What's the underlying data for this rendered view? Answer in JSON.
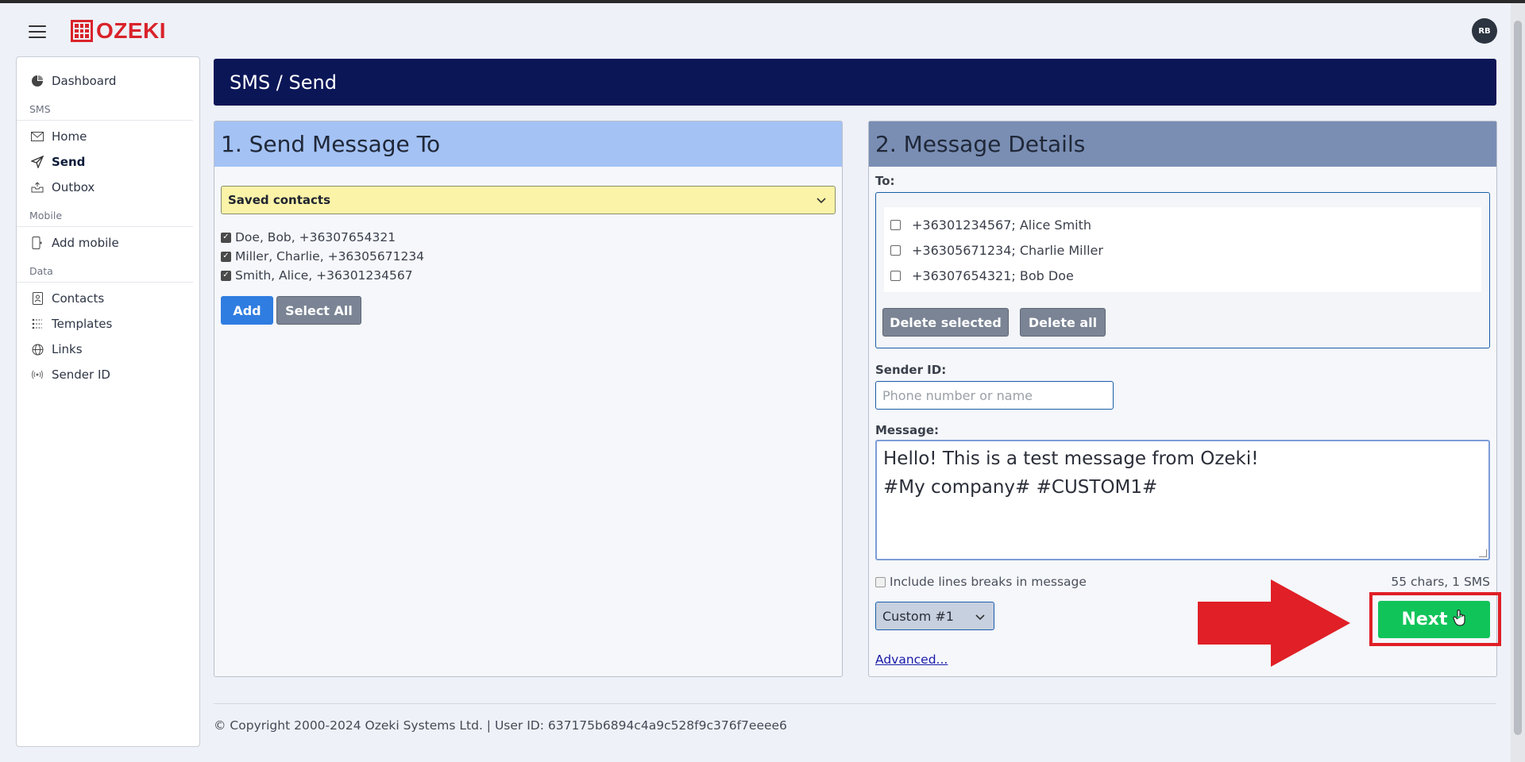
{
  "app": {
    "logo_text": "OZEKI",
    "avatar_initials": "RB"
  },
  "sidebar": {
    "dashboard": "Dashboard",
    "section_sms": "SMS",
    "home": "Home",
    "send": "Send",
    "outbox": "Outbox",
    "section_mobile": "Mobile",
    "add_mobile": "Add mobile",
    "section_data": "Data",
    "contacts": "Contacts",
    "templates": "Templates",
    "links": "Links",
    "sender_id": "Sender ID"
  },
  "header": {
    "title": "SMS / Send"
  },
  "send_to": {
    "heading": "1. Send Message To",
    "source_select": "Saved contacts",
    "contacts": [
      {
        "label": "Doe, Bob, +36307654321",
        "checked": true
      },
      {
        "label": "Miller, Charlie, +36305671234",
        "checked": true
      },
      {
        "label": "Smith, Alice, +36301234567",
        "checked": true
      }
    ],
    "add_label": "Add",
    "select_all_label": "Select All"
  },
  "details": {
    "heading": "2. Message Details",
    "to_label": "To:",
    "recipients": [
      {
        "label": "+36301234567; Alice Smith",
        "checked": false
      },
      {
        "label": "+36305671234; Charlie Miller",
        "checked": false
      },
      {
        "label": "+36307654321; Bob Doe",
        "checked": false
      }
    ],
    "delete_selected_label": "Delete selected",
    "delete_all_label": "Delete all",
    "sender_id_label": "Sender ID:",
    "sender_id_placeholder": "Phone number or name",
    "message_label": "Message:",
    "message_line1": "Hello! This is a test message from Ozeki!",
    "message_line2": "#My company# #CUSTOM1#",
    "include_breaks_label": "Include lines breaks in message",
    "counter": "55 chars, 1 SMS",
    "custom_select": "Custom #1",
    "advanced_link": "Advanced...",
    "next_label": "Next"
  },
  "footer": {
    "copyright": "© Copyright 2000-2024 Ozeki Systems Ltd. | User ID: 637175b6894c4a9c528f9c376f7eeee6"
  },
  "colors": {
    "header_bg": "#0b1657",
    "panel_left_head": "#a4c2f4",
    "panel_right_head": "#7a8eb4",
    "next_button": "#11c45a",
    "highlight": "#e01f26",
    "brand": "#d9232a"
  }
}
